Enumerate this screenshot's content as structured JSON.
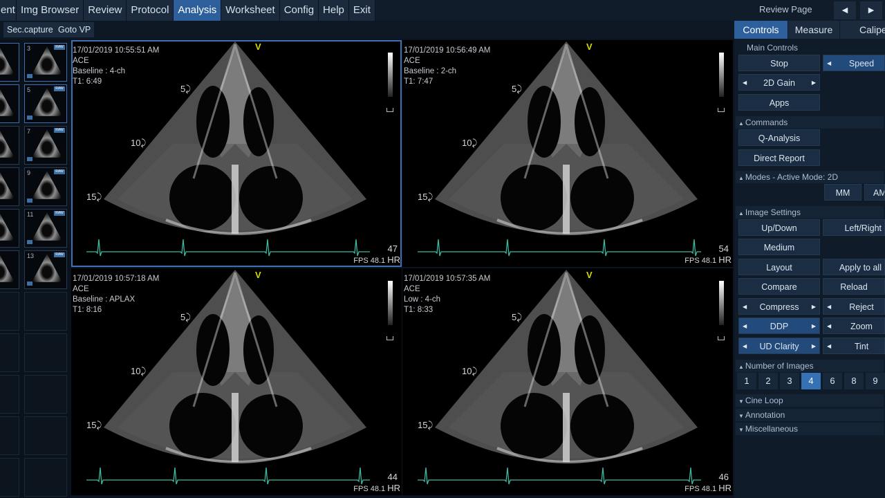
{
  "menu": {
    "items": [
      {
        "label": "ent",
        "active": false
      },
      {
        "label": "Img Browser",
        "active": false
      },
      {
        "label": "Review",
        "active": false
      },
      {
        "label": "Protocol",
        "active": false
      },
      {
        "label": "Analysis",
        "active": true
      },
      {
        "label": "Worksheet",
        "active": false
      },
      {
        "label": "Config",
        "active": false
      },
      {
        "label": "Help",
        "active": false
      },
      {
        "label": "Exit",
        "active": false
      }
    ],
    "review_page": "Review Page",
    "prev_icon": "triangle-left-icon",
    "next_icon": "triangle-right-icon"
  },
  "toolbar": {
    "sec_capture": "Sec.capture",
    "goto_vp": "Goto VP"
  },
  "thumbnails": {
    "numbers": [
      "3",
      "5",
      "7",
      "9",
      "11",
      "13"
    ],
    "raw_label": "RAW"
  },
  "viewports": [
    {
      "timestamp": "17/01/2019 10:55:51 AM",
      "protocol": "ACE",
      "view": "Baseline : 4-ch",
      "t1": "T1: 6:49",
      "hr": "47",
      "fps": "FPS 48.1",
      "hr_label": "HR",
      "marker": "V",
      "depths": [
        "5",
        "10",
        "15"
      ],
      "selected": true
    },
    {
      "timestamp": "17/01/2019 10:56:49 AM",
      "protocol": "ACE",
      "view": "Baseline : 2-ch",
      "t1": "T1: 7:47",
      "hr": "54",
      "fps": "FPS 48.1",
      "hr_label": "HR",
      "marker": "V",
      "depths": [
        "5",
        "10",
        "15"
      ],
      "selected": false
    },
    {
      "timestamp": "17/01/2019 10:57:18 AM",
      "protocol": "ACE",
      "view": "Baseline : APLAX",
      "t1": "T1: 8:16",
      "hr": "44",
      "fps": "FPS 48.1",
      "hr_label": "HR",
      "marker": "V",
      "depths": [
        "5",
        "10",
        "15"
      ],
      "selected": false
    },
    {
      "timestamp": "17/01/2019 10:57:35 AM",
      "protocol": "ACE",
      "view": "Low : 4-ch",
      "t1": "T1: 8:33",
      "hr": "46",
      "fps": "FPS 48.1",
      "hr_label": "HR",
      "marker": "V",
      "depths": [
        "5",
        "10",
        "15"
      ],
      "selected": false
    }
  ],
  "panel": {
    "tabs": [
      "Controls",
      "Measure",
      "Calipe"
    ],
    "active_tab": "Controls",
    "main_controls": "Main Controls",
    "stop": "Stop",
    "speed": "Speed",
    "gain_2d": "2D Gain",
    "apps": "Apps",
    "commands": "Commands",
    "q_analysis": "Q-Analysis",
    "direct_report": "Direct Report",
    "modes": "Modes - Active Mode: 2D",
    "mm": "MM",
    "am": "AM",
    "image_settings": "Image Settings",
    "up_down": "Up/Down",
    "left_right": "Left/Right",
    "medium": "Medium",
    "layout": "Layout",
    "apply_to_all": "Apply to all",
    "compare": "Compare",
    "reload": "Reload",
    "compress": "Compress",
    "reject": "Reject",
    "ddp": "DDP",
    "zoom": "Zoom",
    "ud_clarity": "UD Clarity",
    "tint": "Tint",
    "number_of_images": "Number of Images",
    "image_counts": [
      "1",
      "2",
      "3",
      "4",
      "6",
      "8",
      "9"
    ],
    "active_count": "4",
    "cine_loop": "Cine Loop",
    "annotation": "Annotation",
    "miscellaneous": "Miscellaneous"
  },
  "colors": {
    "accent": "#2d5f9c",
    "ecg": "#3fb8a0",
    "marker": "#d8d800"
  }
}
